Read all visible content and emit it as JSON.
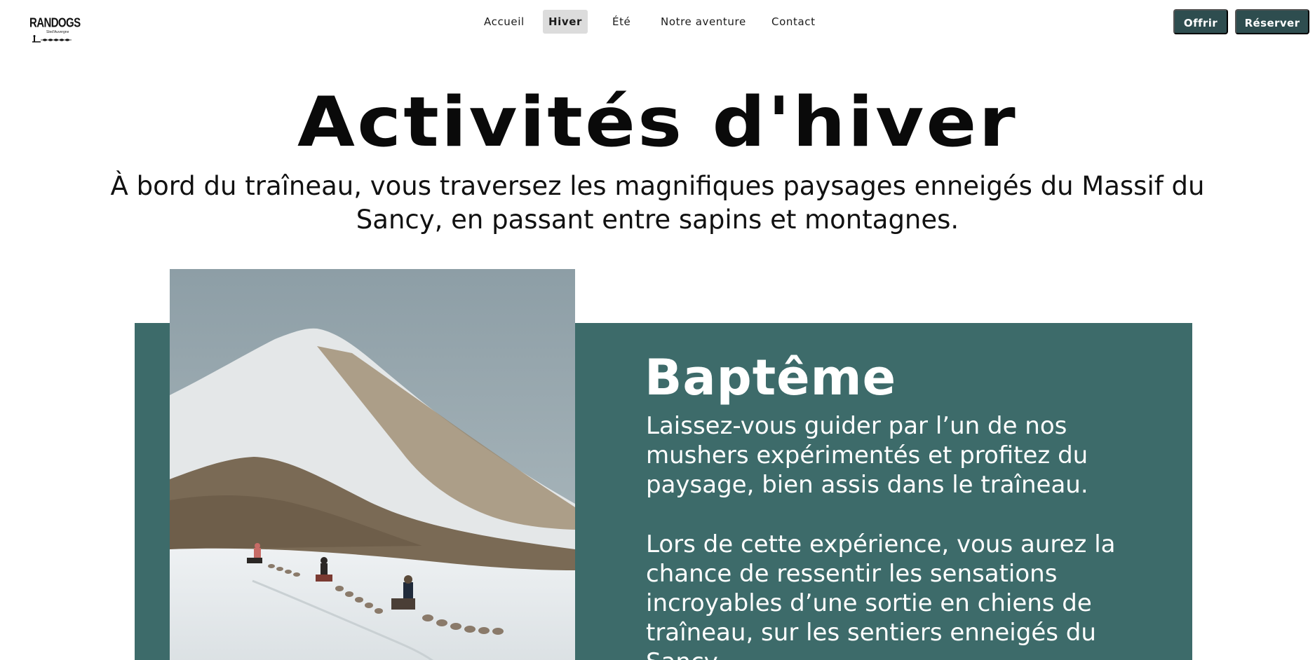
{
  "header": {
    "logo": {
      "brand": "RANDOGS",
      "tagline": "Sled'Auvergne"
    },
    "nav": [
      {
        "label": "Accueil"
      },
      {
        "label": "Hiver",
        "active": true
      },
      {
        "label": "Été"
      },
      {
        "label": "Notre aventure"
      },
      {
        "label": "Contact"
      }
    ],
    "actions": {
      "offer_label": "Offrir",
      "book_label": "Réserver"
    }
  },
  "hero": {
    "title": "Activités d'hiver",
    "subtitle": "À bord du traîneau, vous traversez les magnifiques paysages enneigés du Massif du Sancy, en passant entre sapins et montagnes."
  },
  "activity": {
    "title": "Baptême",
    "paragraph_1": "Laissez-vous guider par l’un de nos mushers expérimentés et profitez du paysage, bien assis dans le traîneau.",
    "paragraph_2": "Lors de cette expérience, vous aurez la chance de ressentir les sensations incroyables d’une sortie en chiens de traîneau, sur les sentiers enneigés du Sancy.",
    "image": {
      "subject": "dog-sled-mountain-photo"
    }
  },
  "colors": {
    "accent": "#2e4d4f",
    "card_background": "#3d6b6a",
    "nav_active_background": "#dcdcdc",
    "text": "#111111",
    "card_text": "#ffffff"
  }
}
